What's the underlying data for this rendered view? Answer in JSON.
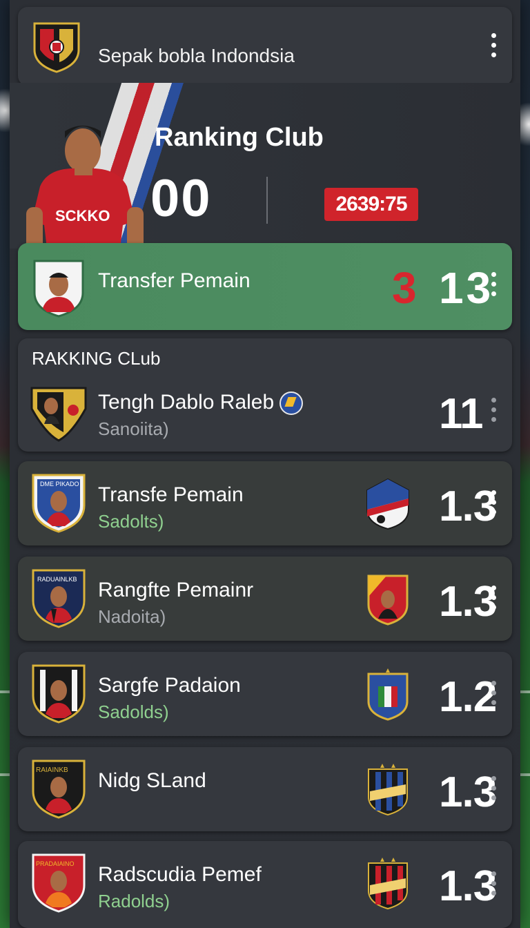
{
  "app": {
    "title": "Sepak bobla Indondsia"
  },
  "hero": {
    "title": "Ranking Club",
    "score": "00",
    "timer": "2639:75",
    "jersey_text": "SCKKO"
  },
  "featured": {
    "name": "Transfer Pemain",
    "score_red": "3",
    "score": "13"
  },
  "section": {
    "label": "RAKKING CLub"
  },
  "rows": [
    {
      "name": "Tengh Dablo Raleb",
      "sub": "Sanoiita)",
      "score": "11",
      "badge_text": ""
    },
    {
      "name": "Transfe Pemain",
      "sub": "Sadolts)",
      "score": "1.3",
      "badge_text": "DME PIKADO"
    },
    {
      "name": "Rangfte Pemainr",
      "sub": "Nadoita)",
      "score": "1.3",
      "badge_text": "RADUAINLKB"
    },
    {
      "name": "Sargfe Padaion",
      "sub": "Sadolds)",
      "score": "1.2",
      "badge_text": ""
    },
    {
      "name": "Nidg SLand",
      "sub": "",
      "score": "1.3",
      "badge_text": "RAIAINKB"
    },
    {
      "name": "Radscudia Pemef",
      "sub": "Radolds)",
      "score": "1.3",
      "badge_text": "PRADAIAINO"
    }
  ],
  "colors": {
    "accent_green": "#4f8f63",
    "accent_red": "#d0242b",
    "sub_green": "#8fd08f",
    "sub_gray": "#a8abb0"
  },
  "icons": {
    "header_logo": "club-crest-icon",
    "menu": "kebab-menu-icon",
    "verified": "verified-badge-icon"
  }
}
